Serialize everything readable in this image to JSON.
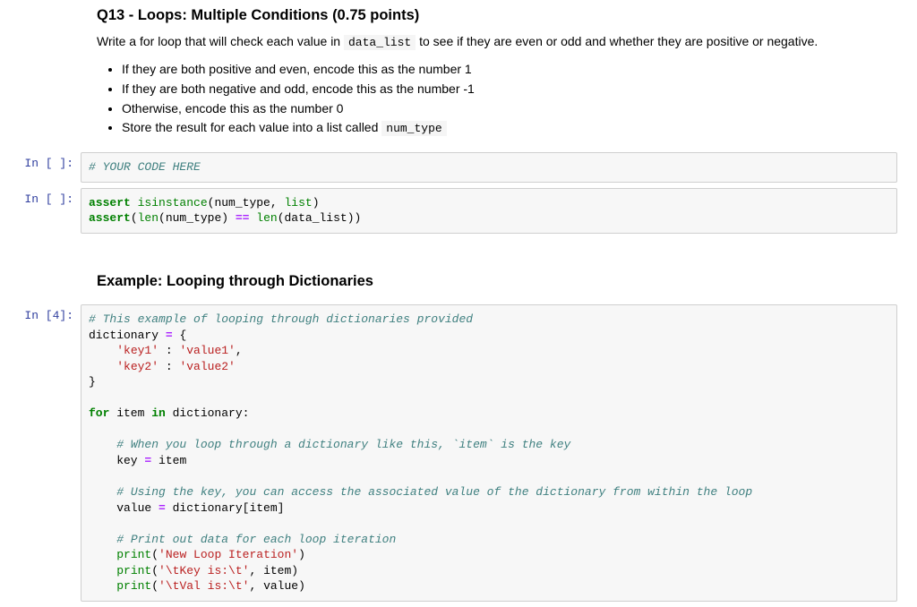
{
  "q13": {
    "heading": "Q13 - Loops: Multiple Conditions (0.75 points)",
    "intro_pre": "Write a for loop that will check each value in ",
    "intro_code": "data_list",
    "intro_post": " to see if they are even or odd and whether they are positive or negative.",
    "bullets": [
      "If they are both positive and even, encode this as the number 1",
      "If they are both negative and odd, encode this as the number -1",
      "Otherwise, encode this as the number 0"
    ],
    "bullet4_pre": "Store the result for each value into a list called ",
    "bullet4_code": "num_type"
  },
  "prompts": {
    "emptyA": "In [ ]:",
    "emptyB": "In [ ]:",
    "four": "In [4]:"
  },
  "codeA": {
    "comment": "# YOUR CODE HERE"
  },
  "codeB": {
    "l1_kw": "assert",
    "l1_builtin": " isinstance",
    "l1_rest": "(num_type, ",
    "l1_builtin2": "list",
    "l1_end": ")",
    "l2_kw": "assert",
    "l2_a": "(",
    "l2_len1": "len",
    "l2_b": "(num_type) ",
    "l2_op": "==",
    "l2_c": " ",
    "l2_len2": "len",
    "l2_d": "(data_list))"
  },
  "dict_heading": "Example: Looping through Dictionaries",
  "codeC": {
    "c1": "# This example of looping through dictionaries provided",
    "l2a": "dictionary ",
    "l2op": "=",
    "l2b": " {",
    "l3a": "    ",
    "l3s1": "'key1'",
    "l3b": " : ",
    "l3s2": "'value1'",
    "l3c": ",",
    "l4a": "    ",
    "l4s1": "'key2'",
    "l4b": " : ",
    "l4s2": "'value2'",
    "l5": "}",
    "l7for": "for",
    "l7a": " item ",
    "l7in": "in",
    "l7b": " dictionary:",
    "c2": "# When you loop through a dictionary like this, `item` is the key",
    "l10a": "    key ",
    "l10op": "=",
    "l10b": " item",
    "c3": "# Using the key, you can access the associated value of the dictionary from within the loop",
    "l13a": "    value ",
    "l13op": "=",
    "l13b": " dictionary[item]",
    "c4": "# Print out data for each loop iteration",
    "l16a": "    ",
    "l16print": "print",
    "l16b": "(",
    "l16s": "'New Loop Iteration'",
    "l16c": ")",
    "l17a": "    ",
    "l17print": "print",
    "l17b": "(",
    "l17s": "'\\tKey is:\\t'",
    "l17c": ", item)",
    "l18a": "    ",
    "l18print": "print",
    "l18b": "(",
    "l18s": "'\\tVal is:\\t'",
    "l18c": ", value)"
  }
}
